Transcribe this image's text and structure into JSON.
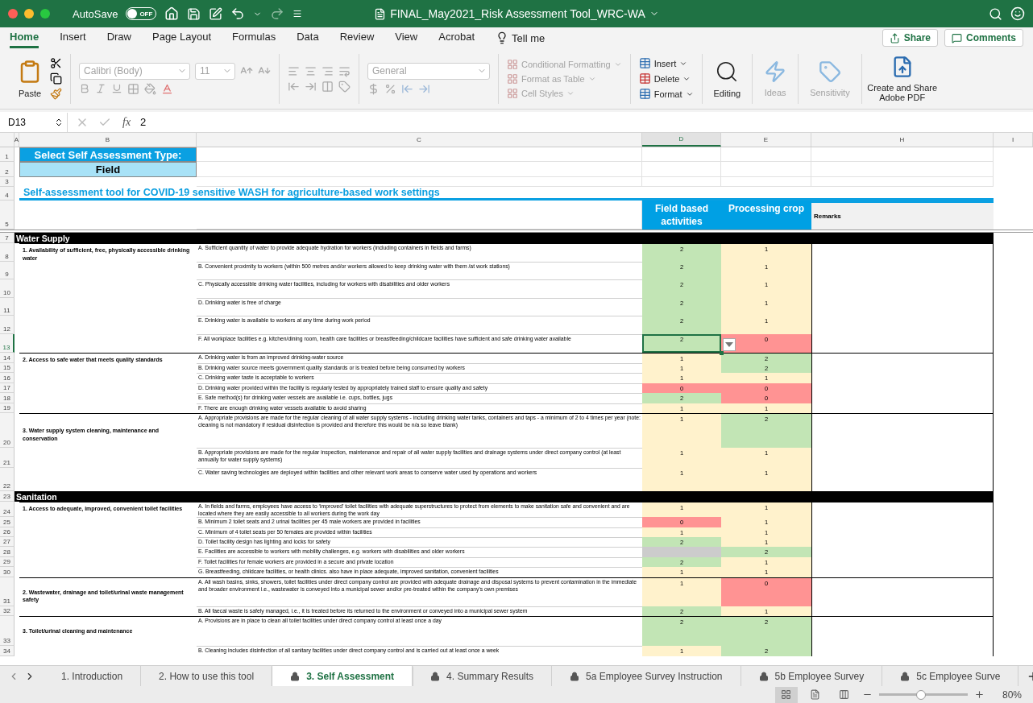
{
  "title_bar": {
    "autosave_label": "AutoSave",
    "autosave_on": false,
    "autosave_state": "OFF",
    "title": "FINAL_May2021_Risk Assessment Tool_WRC-WA"
  },
  "menu_tabs": [
    {
      "label": "Home",
      "selected": true
    },
    {
      "label": "Insert",
      "selected": false
    },
    {
      "label": "Draw",
      "selected": false
    },
    {
      "label": "Page Layout",
      "selected": false
    },
    {
      "label": "Formulas",
      "selected": false
    },
    {
      "label": "Data",
      "selected": false
    },
    {
      "label": "Review",
      "selected": false
    },
    {
      "label": "View",
      "selected": false
    },
    {
      "label": "Acrobat",
      "selected": false
    }
  ],
  "tell_me": "Tell me",
  "share": "Share",
  "comments": "Comments",
  "ribbon": {
    "paste": {
      "label": "Paste",
      "disabled": false
    },
    "font_name": {
      "label": "Calibri (Body)",
      "disabled": true
    },
    "font_size": {
      "label": "11",
      "disabled": true
    },
    "number_format": {
      "label": "General",
      "disabled": true
    },
    "styles": [
      {
        "label": "Conditional Formatting",
        "disabled": true
      },
      {
        "label": "Format as Table",
        "disabled": true
      },
      {
        "label": "Cell Styles",
        "disabled": true
      }
    ],
    "cells": [
      {
        "label": "Insert",
        "disabled": false
      },
      {
        "label": "Delete",
        "disabled": false
      },
      {
        "label": "Format",
        "disabled": false
      }
    ],
    "editing": {
      "label": "Editing",
      "disabled": false
    },
    "ideas": {
      "label": "Ideas",
      "disabled": true
    },
    "sensitivity": {
      "label": "Sensitivity",
      "disabled": true
    },
    "adobe": {
      "label": "Create and Share Adobe PDF",
      "disabled": false
    }
  },
  "formula_bar": {
    "cell_ref": "D13",
    "function_symbol": "fx",
    "value": "2"
  },
  "columns": [
    {
      "label": "A",
      "selected": false
    },
    {
      "label": "B",
      "selected": false
    },
    {
      "label": "C",
      "selected": false
    },
    {
      "label": "D",
      "selected": true
    },
    {
      "label": "E",
      "selected": false
    },
    {
      "label": "H",
      "selected": false
    },
    {
      "label": "I",
      "selected": false
    }
  ],
  "sheet": {
    "top_rows": [
      "1",
      "2",
      "3",
      "4",
      "5"
    ],
    "type_label": "Select Self Assessment Type:",
    "type_value": "Field",
    "heading": "Self-assessment tool for COVID-19 sensitive WASH for agriculture-based work settings",
    "score_headers": [
      "Field based activities",
      "Processing crop"
    ],
    "remarks_header": "Remarks",
    "sections": [
      {
        "row": "7",
        "title": "Water Supply",
        "groups": [
          {
            "label": "1. Availability of sufficient, free, physically accessible drinking water",
            "items": [
              {
                "row": "8",
                "text": "A. Sufficient quantity of water to provide adequate hydration for workers (including containers in fields and farms)",
                "field": {
                  "value": "2",
                  "color": "#c2e5b5"
                },
                "crop": {
                  "value": "1",
                  "color": "#fff2cc"
                },
                "selected": false
              },
              {
                "row": "9",
                "text": "B. Convenient proximity to workers (within 500 metres and/or workers allowed to keep drinking water with them /at work stations)",
                "field": {
                  "value": "2",
                  "color": "#c2e5b5"
                },
                "crop": {
                  "value": "1",
                  "color": "#fff2cc"
                },
                "selected": false
              },
              {
                "row": "10",
                "text": "C. Physically accessible drinking water facilities, including for workers with disabilities and older workers",
                "field": {
                  "value": "2",
                  "color": "#c2e5b5"
                },
                "crop": {
                  "value": "1",
                  "color": "#fff2cc"
                },
                "selected": false
              },
              {
                "row": "11",
                "text": "D. Drinking water is free of charge",
                "field": {
                  "value": "2",
                  "color": "#c2e5b5"
                },
                "crop": {
                  "value": "1",
                  "color": "#fff2cc"
                },
                "selected": false
              },
              {
                "row": "12",
                "text": "E. Drinking water is available to workers at any time during work period",
                "field": {
                  "value": "2",
                  "color": "#c2e5b5"
                },
                "crop": {
                  "value": "1",
                  "color": "#fff2cc"
                },
                "selected": false
              },
              {
                "row": "13",
                "text": "F. All workplace facilities e.g. kitchen/dining room, health care facilities or breastfeeding/childcare facilities have sufficient and safe drinking water available",
                "field": {
                  "value": "2",
                  "color": "#c2e5b5"
                },
                "crop": {
                  "value": "0",
                  "color": "#ff9393"
                },
                "selected": true
              }
            ]
          },
          {
            "label": "2. Access to safe water that meets quality standards",
            "items": [
              {
                "row": "14",
                "text": "A. Drinking water is from an improved drinking-water source",
                "field": {
                  "value": "1",
                  "color": "#fff2cc"
                },
                "crop": {
                  "value": "2",
                  "color": "#c2e5b5"
                },
                "selected": false
              },
              {
                "row": "15",
                "text": "B. Drinking water source meets government quality standards or is treated before being consumed by workers",
                "field": {
                  "value": "1",
                  "color": "#fff2cc"
                },
                "crop": {
                  "value": "2",
                  "color": "#c2e5b5"
                },
                "selected": false
              },
              {
                "row": "16",
                "text": "C. Drinking water taste is acceptable to workers",
                "field": {
                  "value": "1",
                  "color": "#fff2cc"
                },
                "crop": {
                  "value": "1",
                  "color": "#fff2cc"
                },
                "selected": false
              },
              {
                "row": "17",
                "text": "D. Drinking water provided within the facility is regularly tested by appropriately trained staff to ensure quality and safety",
                "field": {
                  "value": "0",
                  "color": "#ff9393"
                },
                "crop": {
                  "value": "0",
                  "color": "#ff9393"
                },
                "selected": false
              },
              {
                "row": "18",
                "text": "E. Safe method(s) for drinking water vessels are available i.e. cups, bottles, jugs",
                "field": {
                  "value": "2",
                  "color": "#c2e5b5"
                },
                "crop": {
                  "value": "0",
                  "color": "#ff9393"
                },
                "selected": false
              },
              {
                "row": "19",
                "text": "F. There are enough drinking water vessels available to avoid sharing",
                "field": {
                  "value": "1",
                  "color": "#fff2cc"
                },
                "crop": {
                  "value": "1",
                  "color": "#fff2cc"
                },
                "selected": false
              }
            ]
          },
          {
            "label": "3. Water supply system cleaning, maintenance and conservation",
            "items": [
              {
                "row": "20",
                "text": "A. Appropriate provisions are made for the regular cleaning of all water supply systems - including drinking water tanks, containers and taps - a minimum of 2 to 4 times per year (note: cleaning is not mandatory if residual disinfection is provided and therefore this would be n/a so leave blank)",
                "field": {
                  "value": "1",
                  "color": "#fff2cc"
                },
                "crop": {
                  "value": "2",
                  "color": "#c2e5b5"
                },
                "selected": false
              },
              {
                "row": "21",
                "text": "B. Appropriate provisions are made for the regular inspection, maintenance and repair of all water supply facilities and drainage systems under direct company control (at least annually for water supply systems)",
                "field": {
                  "value": "1",
                  "color": "#fff2cc"
                },
                "crop": {
                  "value": "1",
                  "color": "#fff2cc"
                },
                "selected": false
              },
              {
                "row": "22",
                "text": "C. Water saving technologies are deployed within facilities and other relevant work areas to conserve water used by operations and workers",
                "field": {
                  "value": "1",
                  "color": "#fff2cc"
                },
                "crop": {
                  "value": "1",
                  "color": "#fff2cc"
                },
                "selected": false
              }
            ]
          }
        ]
      },
      {
        "row": "23",
        "title": "Sanitation",
        "groups": [
          {
            "label": "1. Access to adequate, improved, convenient toilet facilities",
            "items": [
              {
                "row": "24",
                "text": "A. In fields and farms, employees have access to ‘improved’ toilet facilities with adequate superstructures to protect from elements to make sanitation safe and convenient and are located where they are easily accessible to all workers during the work day",
                "field": {
                  "value": "1",
                  "color": "#fff2cc"
                },
                "crop": {
                  "value": "1",
                  "color": "#fff2cc"
                },
                "selected": false
              },
              {
                "row": "25",
                "text": "B. Minimum 2 toilet seats and 2 urinal facilities per 45 male workers are provided in facilities",
                "field": {
                  "value": "0",
                  "color": "#ff9393"
                },
                "crop": {
                  "value": "1",
                  "color": "#fff2cc"
                },
                "selected": false
              },
              {
                "row": "26",
                "text": "C. Minimum of 4 toilet seats per 50 females are provided within facilities",
                "field": {
                  "value": "1",
                  "color": "#fff2cc"
                },
                "crop": {
                  "value": "1",
                  "color": "#fff2cc"
                },
                "selected": false
              },
              {
                "row": "27",
                "text": "D. Toilet facility design has lighting and locks for safety",
                "field": {
                  "value": "2",
                  "color": "#c2e5b5"
                },
                "crop": {
                  "value": "1",
                  "color": "#fff2cc"
                },
                "selected": false
              },
              {
                "row": "28",
                "text": "E. Facilities are accessible to workers with mobility challenges, e.g. workers with disabilities and older workers",
                "field": {
                  "color": "#cccccc"
                },
                "crop": {
                  "value": "2",
                  "color": "#c2e5b5"
                },
                "selected": false
              },
              {
                "row": "29",
                "text": "F. Toilet facilities for female workers are provided in a secure and private location",
                "field": {
                  "value": "2",
                  "color": "#c2e5b5"
                },
                "crop": {
                  "value": "1",
                  "color": "#fff2cc"
                },
                "selected": false
              },
              {
                "row": "30",
                "text": "G. Breastfeeding, childcare facilities, or health clinics. also have in place adequate, improved sanitation, convenient facilities",
                "field": {
                  "value": "1",
                  "color": "#fff2cc"
                },
                "crop": {
                  "value": "1",
                  "color": "#fff2cc"
                },
                "selected": false
              }
            ]
          },
          {
            "label": "2. Wastewater, drainage and toilet/urinal waste management safety",
            "items": [
              {
                "row": "31",
                "text": "A. All wash basins, sinks, showers, toilet facilities under direct company control are provided with adequate drainage and disposal systems to prevent contamination in the immediate and broader environment i.e., wastewater is conveyed into a municipal sewer and/or pre-treated within the company’s own premises",
                "field": {
                  "value": "1",
                  "color": "#fff2cc"
                },
                "crop": {
                  "value": "0",
                  "color": "#ff9393"
                },
                "selected": false
              },
              {
                "row": "32",
                "text": "B. All faecal waste is safely managed, i.e., it is treated before its returned to the environment or conveyed into a municipal sewer system",
                "field": {
                  "value": "2",
                  "color": "#c2e5b5"
                },
                "crop": {
                  "value": "1",
                  "color": "#fff2cc"
                },
                "selected": false
              }
            ]
          },
          {
            "label": "3. Toilet/urinal cleaning and maintenance",
            "items": [
              {
                "row": "33",
                "text": "A. Provisions are in place to clean all toilet facilities under direct company control at least once a day",
                "field": {
                  "value": "2",
                  "color": "#c2e5b5"
                },
                "crop": {
                  "value": "2",
                  "color": "#c2e5b5"
                },
                "selected": false
              },
              {
                "row": "34",
                "text": "B. Cleaning includes disinfection of all sanitary facilities under direct company control and is carried out at least once a week",
                "field": {
                  "value": "1",
                  "color": "#fff2cc"
                },
                "crop": {
                  "value": "2",
                  "color": "#c2e5b5"
                },
                "selected": false
              }
            ]
          }
        ]
      }
    ]
  },
  "sheet_tabs": [
    {
      "label": "1. Introduction",
      "locked": false,
      "selected": false
    },
    {
      "label": "2. How to use this tool",
      "locked": false,
      "selected": false
    },
    {
      "label": "3. Self Assessment",
      "locked": true,
      "selected": true
    },
    {
      "label": "4. Summary Results",
      "locked": true,
      "selected": false
    },
    {
      "label": "5a Employee Survey Instruction",
      "locked": true,
      "selected": false
    },
    {
      "label": "5b Employee Survey",
      "locked": true,
      "selected": false
    },
    {
      "label": "5c Employee Surve",
      "locked": true,
      "selected": false
    }
  ],
  "status_bar": {
    "views": [
      {
        "kind": "normal",
        "selected": true
      },
      {
        "kind": "page_layout",
        "selected": false
      },
      {
        "kind": "page_break",
        "selected": false
      }
    ],
    "zoom": {
      "level": 0.47,
      "label": "80%"
    }
  }
}
